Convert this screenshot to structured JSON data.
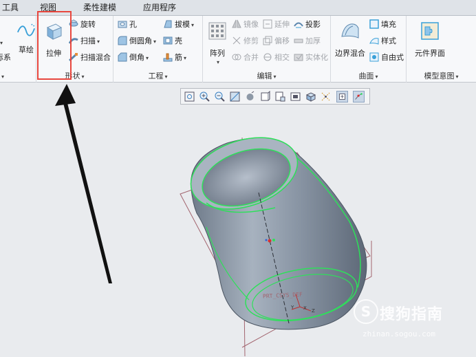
{
  "tabs": [
    "工具",
    "视图",
    "柔性建模",
    "应用程序"
  ],
  "ribbon": {
    "datum_group": {
      "coord_label": "坐标系",
      "sketch_label": "草绘"
    },
    "shape_group": {
      "label": "形状",
      "extrude_label": "拉伸",
      "revolve_label": "旋转",
      "sweep_label": "扫描",
      "swept_blend_label": "扫描混合"
    },
    "engineering_group": {
      "label": "工程",
      "hole_label": "孔",
      "draft_label": "拔模",
      "round_label": "倒圆角",
      "shell_label": "壳",
      "chamfer_label": "倒角",
      "rib_label": "筋"
    },
    "editing_group": {
      "label": "编辑",
      "pattern_label": "阵列",
      "mirror_label": "镜像",
      "extend_label": "延伸",
      "project_label": "投影",
      "trim_label": "修剪",
      "offset_label": "偏移",
      "thicken_label": "加厚",
      "merge_label": "合并",
      "intersect_label": "相交",
      "solidify_label": "实体化"
    },
    "surfaces_group": {
      "label": "曲面",
      "boundary_blend_label": "边界混合",
      "fill_label": "填充",
      "style_label": "样式",
      "freestyle_label": "自由式"
    },
    "model_intent_group": {
      "label": "模型意图",
      "component_interface_label": "元件界面"
    }
  },
  "view_toolbar": {
    "buttons": [
      "refit-icon",
      "zoom-in-icon",
      "zoom-out-icon",
      "repaint-icon",
      "display-style-icon",
      "saved-orientations-icon",
      "named-views-icon",
      "view-manager-icon",
      "perspective-icon",
      "datum-display-icon",
      "spin-center-icon",
      "annotation-display-icon"
    ]
  },
  "viewport": {
    "csys_label": "PRT_CSYS_DEF",
    "axis_x": "X",
    "axis_y": "Y",
    "axis_z": "Z"
  },
  "watermark": {
    "brand": "搜狗指南",
    "url": "zhinan.sogou.com"
  },
  "colors": {
    "accent_highlight": "#e8463d",
    "model_body": "#8d99a8",
    "edge_highlight": "#2ee05a",
    "datum_plane": "#a2646e",
    "background": "#e9ebee"
  }
}
